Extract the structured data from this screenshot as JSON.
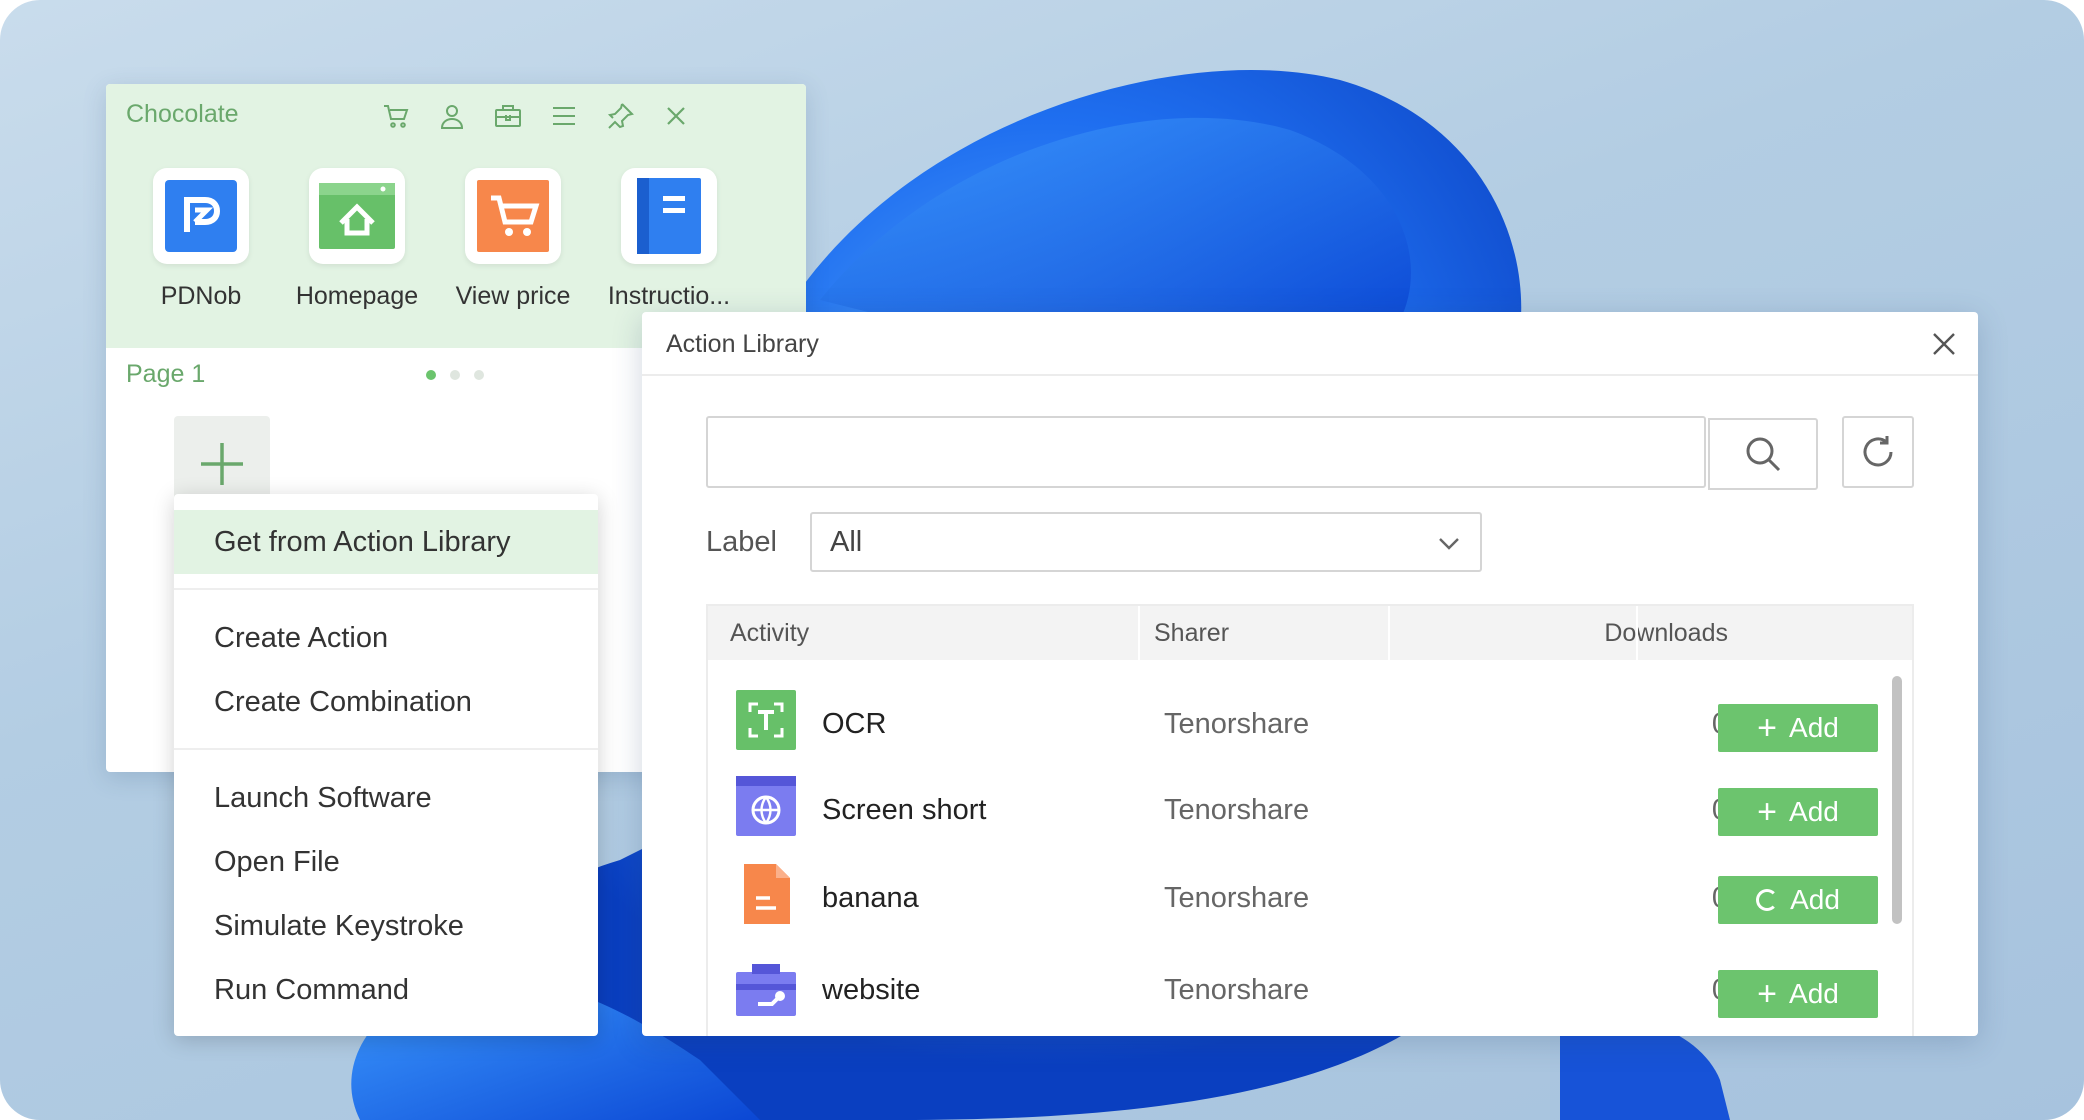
{
  "launcher": {
    "title": "Chocolate",
    "toolbar_icons": [
      "cart-icon",
      "user-icon",
      "toolbox-icon",
      "menu-icon",
      "pin-icon",
      "close-icon"
    ],
    "apps": [
      {
        "label": "PDNob",
        "icon": "pdnob-icon",
        "color": "#2f7ff0"
      },
      {
        "label": "Homepage",
        "icon": "homepage-icon",
        "color": "#67c069"
      },
      {
        "label": "View price",
        "icon": "cart-app-icon",
        "color": "#f7874b"
      },
      {
        "label": "Instructio...",
        "icon": "document-icon",
        "color": "#2f7ff0"
      }
    ],
    "page_label": "Page 1",
    "pages": 3,
    "current_page": 1
  },
  "context_menu": {
    "items": [
      {
        "label": "Get from Action Library",
        "highlighted": true
      },
      {
        "label": "Create Action"
      },
      {
        "label": "Create Combination"
      },
      {
        "label": "Launch Software"
      },
      {
        "label": "Open File"
      },
      {
        "label": "Simulate Keystroke"
      },
      {
        "label": "Run Command"
      }
    ]
  },
  "dialog": {
    "title": "Action Library",
    "search": {
      "value": "",
      "placeholder": ""
    },
    "filter": {
      "label": "Label",
      "value": "All"
    },
    "columns": {
      "activity": "Activity",
      "sharer": "Sharer",
      "downloads": "Downloads"
    },
    "rows": [
      {
        "name": "OCR",
        "sharer": "Tenorshare",
        "downloads": "0",
        "add_label": "Add",
        "icon": "ocr-icon",
        "state": "idle"
      },
      {
        "name": "Screen short",
        "sharer": "Tenorshare",
        "downloads": "0",
        "add_label": "Add",
        "icon": "globe-window-icon",
        "state": "idle"
      },
      {
        "name": "banana",
        "sharer": "Tenorshare",
        "downloads": "0",
        "add_label": "Add",
        "icon": "file-icon",
        "state": "loading"
      },
      {
        "name": "website",
        "sharer": "Tenorshare",
        "downloads": "0",
        "add_label": "Add",
        "icon": "toolbox-wrench-icon",
        "state": "idle"
      }
    ]
  },
  "colors": {
    "accent_green": "#6cc46e",
    "title_green": "#6aa86c",
    "launcher_header": "#e2f3e3"
  }
}
